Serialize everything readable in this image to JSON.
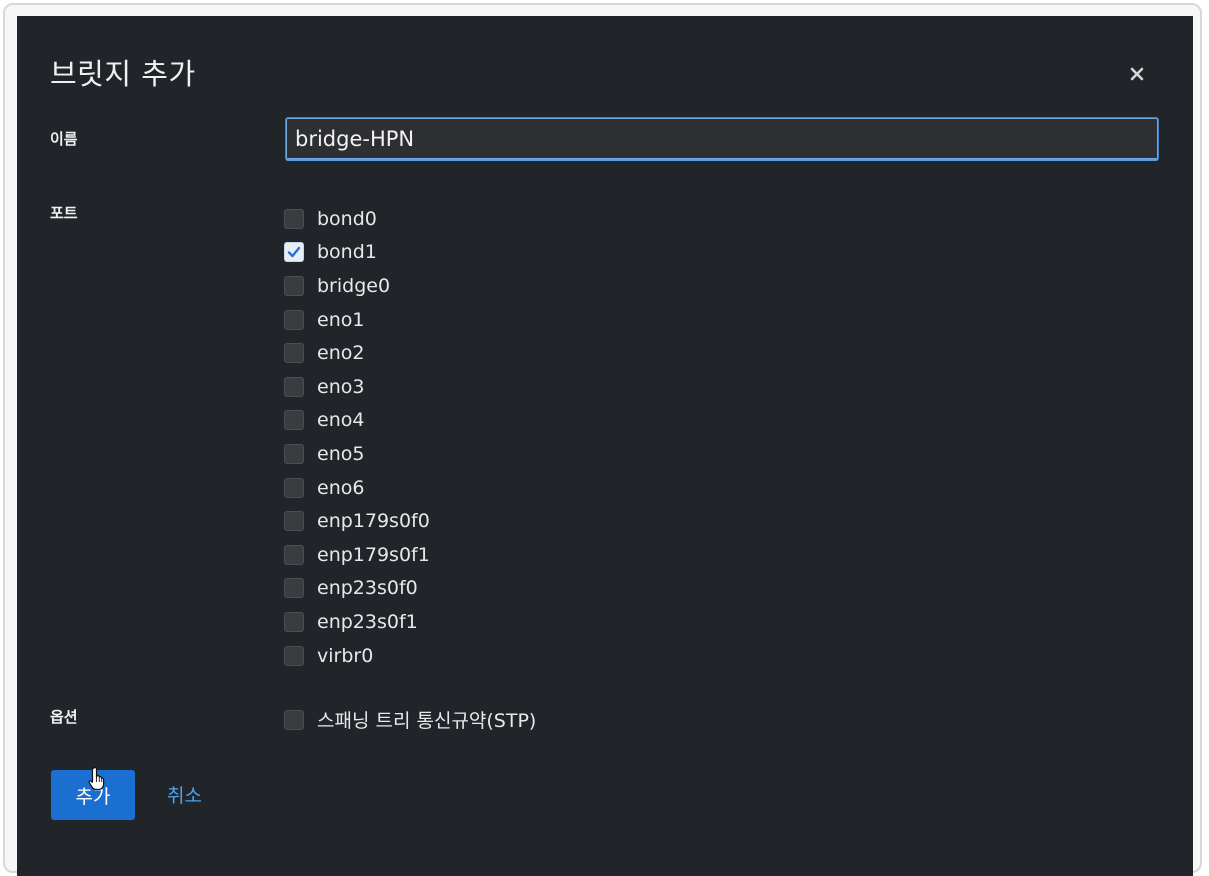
{
  "dialog": {
    "title": "브릿지 추가",
    "close_icon": "close-icon"
  },
  "form": {
    "name_label": "이름",
    "name_value": "bridge-HPN",
    "ports_label": "포트",
    "ports": [
      {
        "label": "bond0",
        "checked": false
      },
      {
        "label": "bond1",
        "checked": true
      },
      {
        "label": "bridge0",
        "checked": false
      },
      {
        "label": "eno1",
        "checked": false
      },
      {
        "label": "eno2",
        "checked": false
      },
      {
        "label": "eno3",
        "checked": false
      },
      {
        "label": "eno4",
        "checked": false
      },
      {
        "label": "eno5",
        "checked": false
      },
      {
        "label": "eno6",
        "checked": false
      },
      {
        "label": "enp179s0f0",
        "checked": false
      },
      {
        "label": "enp179s0f1",
        "checked": false
      },
      {
        "label": "enp23s0f0",
        "checked": false
      },
      {
        "label": "enp23s0f1",
        "checked": false
      },
      {
        "label": "virbr0",
        "checked": false
      }
    ],
    "options_label": "옵션",
    "stp_label": "스패닝 트리 통신규약(STP)",
    "stp_checked": false
  },
  "actions": {
    "add_label": "추가",
    "cancel_label": "취소"
  },
  "colors": {
    "dialog_bg": "#212429",
    "primary": "#1a6fd0",
    "link": "#4da3ec",
    "input_focus": "#3d81c4"
  }
}
